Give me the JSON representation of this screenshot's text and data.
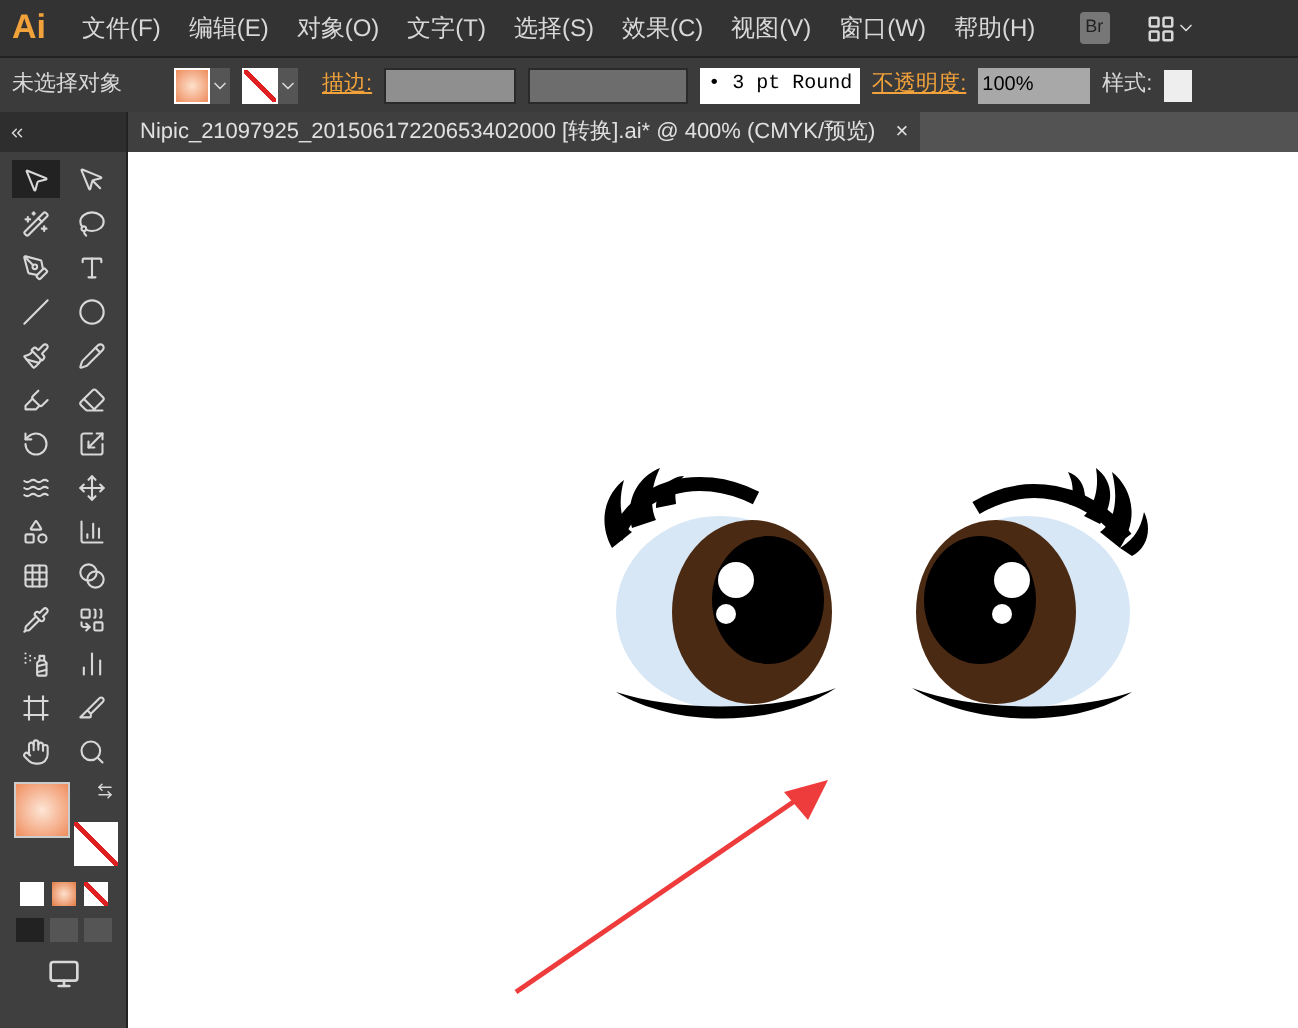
{
  "app": {
    "logo": "Ai"
  },
  "menu": [
    "文件(F)",
    "编辑(E)",
    "对象(O)",
    "文字(T)",
    "选择(S)",
    "效果(C)",
    "视图(V)",
    "窗口(W)",
    "帮助(H)"
  ],
  "bridge_button": "Br",
  "control_bar": {
    "selection": "未选择对象",
    "stroke_label": "描边:",
    "stroke_profile": "• 3 pt Round",
    "opacity_label": "不透明度:",
    "opacity": "100%",
    "style_label": "样式:"
  },
  "document_tab": {
    "title": "Nipic_21097925_20150617220653402000  [转换].ai* @ 400% (CMYK/预览)",
    "close": "×",
    "selected": true
  },
  "tools": [
    {
      "kind": "selection",
      "selected": true
    },
    {
      "kind": "direct",
      "selected": false
    },
    {
      "kind": "wand",
      "selected": false
    },
    {
      "kind": "lasso",
      "selected": false
    },
    {
      "kind": "pen",
      "selected": false
    },
    {
      "kind": "type",
      "selected": false
    },
    {
      "kind": "line",
      "selected": false
    },
    {
      "kind": "ellipse",
      "selected": false
    },
    {
      "kind": "brush",
      "selected": false
    },
    {
      "kind": "pencil",
      "selected": false
    },
    {
      "kind": "blob",
      "selected": false
    },
    {
      "kind": "eraser",
      "selected": false
    },
    {
      "kind": "rotate",
      "selected": false
    },
    {
      "kind": "scale",
      "selected": false
    },
    {
      "kind": "warp",
      "selected": false
    },
    {
      "kind": "transform",
      "selected": false
    },
    {
      "kind": "shapes",
      "selected": false
    },
    {
      "kind": "perspective",
      "selected": false
    },
    {
      "kind": "mesh",
      "selected": false
    },
    {
      "kind": "gradient",
      "selected": false
    },
    {
      "kind": "eyedropper",
      "selected": false
    },
    {
      "kind": "blend",
      "selected": false
    },
    {
      "kind": "spray",
      "selected": false
    },
    {
      "kind": "graph",
      "selected": false
    },
    {
      "kind": "artboard",
      "selected": false
    },
    {
      "kind": "slice",
      "selected": false
    },
    {
      "kind": "hand",
      "selected": false
    },
    {
      "kind": "zoom",
      "selected": false
    }
  ]
}
